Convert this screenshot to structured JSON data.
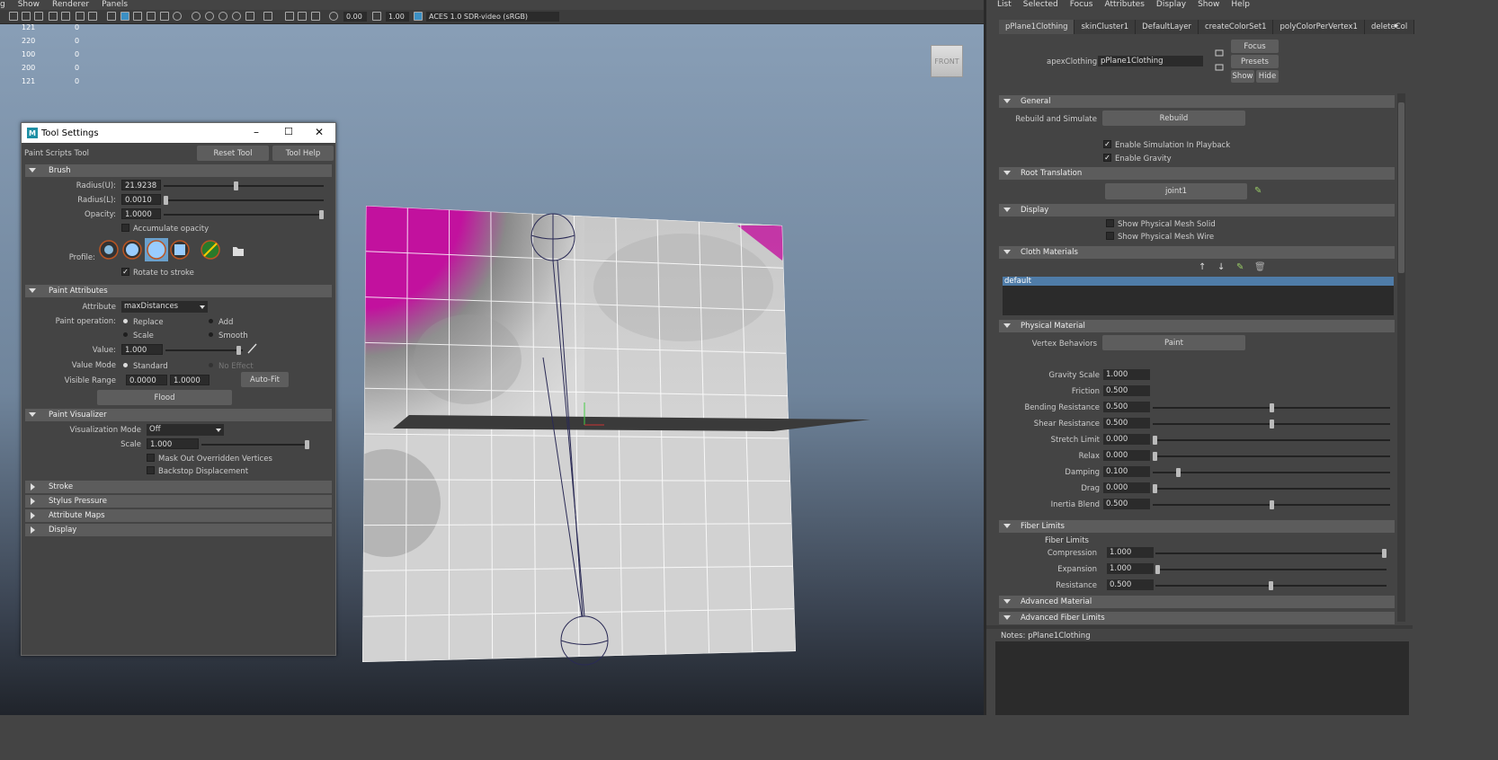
{
  "viewport": {
    "menu": [
      "g",
      "Show",
      "Renderer",
      "Panels"
    ],
    "toolbar": {
      "field1": "0.00",
      "field2": "1.00",
      "colorspace": "ACES 1.0 SDR-video (sRGB)"
    },
    "hud_rows": [
      [
        "121",
        "0"
      ],
      [
        "220",
        "0"
      ],
      [
        "100",
        "0"
      ],
      [
        "200",
        "0"
      ],
      [
        "121",
        "0"
      ]
    ],
    "viewcube": "FRONT"
  },
  "tool": {
    "title": "Tool Settings",
    "tool_name": "Paint Scripts Tool",
    "reset": "Reset Tool",
    "help": "Tool Help",
    "brush": {
      "header": "Brush",
      "radius_u_label": "Radius(U):",
      "radius_u": "21.9238",
      "radius_u_level": 0.45,
      "radius_l_label": "Radius(L):",
      "radius_l": "0.0010",
      "radius_l_level": 0.0,
      "opacity_label": "Opacity:",
      "opacity": "1.0000",
      "opacity_level": 1.0,
      "accumulate": "Accumulate opacity",
      "profile_label": "Profile:",
      "rotate": "Rotate to stroke"
    },
    "paint_attr": {
      "header": "Paint Attributes",
      "attribute_label": "Attribute",
      "attribute": "maxDistances",
      "operation_label": "Paint operation:",
      "ops": [
        "Replace",
        "Add",
        "Scale",
        "Smooth"
      ],
      "value_label": "Value:",
      "value": "1.000",
      "value_level": 0.98,
      "value_mode_label": "Value Mode",
      "mode_standard": "Standard",
      "mode_noeffect": "No Effect",
      "visible_range_label": "Visible Range",
      "range_min": "0.0000",
      "range_max": "1.0000",
      "autofit": "Auto-Fit",
      "flood": "Flood"
    },
    "visualizer": {
      "header": "Paint Visualizer",
      "mode_label": "Visualization Mode",
      "mode": "Off",
      "scale_label": "Scale",
      "scale": "1.000",
      "scale_level": 1.0,
      "mask": "Mask Out Overridden Vertices",
      "backstop": "Backstop Displacement"
    },
    "collapsed": [
      "Stroke",
      "Stylus Pressure",
      "Attribute Maps",
      "Display"
    ]
  },
  "attr": {
    "menu": [
      "List",
      "Selected",
      "Focus",
      "Attributes",
      "Display",
      "Show",
      "Help"
    ],
    "tabs": [
      "pPlane1Clothing",
      "skinCluster1",
      "DefaultLayer",
      "createColorSet1",
      "polyColorPerVertex1",
      "deleteCol"
    ],
    "node_label": "apexClothing:",
    "node": "pPlane1Clothing",
    "focus": "Focus",
    "presets": "Presets",
    "show": "Show",
    "hide": "Hide",
    "general": "General",
    "rebuild_label": "Rebuild and Simulate",
    "rebuild": "Rebuild",
    "enable_sim": "Enable Simulation In Playback",
    "enable_grav": "Enable Gravity",
    "root": "Root Translation",
    "joint": "joint1",
    "display": "Display",
    "mesh_solid": "Show Physical Mesh Solid",
    "mesh_wire": "Show Physical Mesh Wire",
    "cloth_mat": "Cloth Materials",
    "material_item": "default",
    "phys_mat": "Physical Material",
    "vertex_label": "Vertex Behaviors",
    "paint": "Paint",
    "params": [
      {
        "label": "Gravity Scale",
        "value": "1.000",
        "level": null
      },
      {
        "label": "Friction",
        "value": "0.500",
        "level": null
      },
      {
        "label": "Bending Resistance",
        "value": "0.500",
        "level": 0.5
      },
      {
        "label": "Shear Resistance",
        "value": "0.500",
        "level": 0.5
      },
      {
        "label": "Stretch Limit",
        "value": "0.000",
        "level": 0.0
      },
      {
        "label": "Relax",
        "value": "0.000",
        "level": 0.0
      },
      {
        "label": "Damping",
        "value": "0.100",
        "level": 0.1
      },
      {
        "label": "Drag",
        "value": "0.000",
        "level": 0.0
      },
      {
        "label": "Inertia Blend",
        "value": "0.500",
        "level": 0.5
      }
    ],
    "fiber": "Fiber Limits",
    "fiber_sub": "Fiber Limits",
    "fiber_params": [
      {
        "label": "Compression",
        "value": "1.000",
        "level": 1.0
      },
      {
        "label": "Expansion",
        "value": "1.000",
        "level": 0.0
      },
      {
        "label": "Resistance",
        "value": "0.500",
        "level": 0.5
      }
    ],
    "adv_mat": "Advanced Material",
    "adv_fiber": "Advanced Fiber Limits",
    "notes": "Notes:  pPlane1Clothing"
  },
  "colors": {
    "magenta": "#c2119e",
    "select": "#4f7ca8"
  }
}
